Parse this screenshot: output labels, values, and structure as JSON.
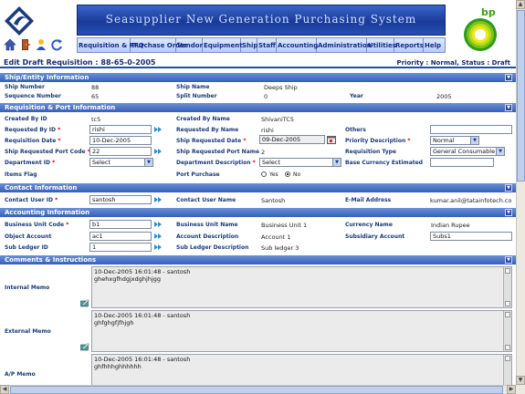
{
  "app_title": "Seasupplier New Generation Purchasing System",
  "brand": {
    "bp_text": "bp",
    "accent": "#2450b0",
    "section_color": "#3560b8",
    "required_color": "#d00000"
  },
  "toolbar_icons": [
    "home-icon",
    "exit-door-icon",
    "user-icon",
    "refresh-icon"
  ],
  "menu": {
    "items": [
      "Requisition & RFQ",
      "Purchase Order",
      "Vendor",
      "Equipment",
      "Ship",
      "Staff",
      "Accounting",
      "Administration",
      "Utilities",
      "Reports",
      "Help"
    ]
  },
  "page": {
    "title": "Edit Draft Requisition : 88-65-0-2005",
    "status": "Priority : Normal, Status : Draft"
  },
  "ship_entity": {
    "header": "Ship/Entity Information",
    "ship_number_label": "Ship Number",
    "ship_number": "88",
    "ship_name_label": "Ship Name",
    "ship_name": "Deeps Ship",
    "sequence_number_label": "Sequence Number",
    "sequence_number": "65",
    "split_number_label": "Split Number",
    "split_number": "0",
    "year_label": "Year",
    "year": "2005"
  },
  "requisition": {
    "header": "Requisition & Port Information",
    "created_by_id_label": "Created By ID",
    "created_by_id": "tc5",
    "created_by_name_label": "Created By Name",
    "created_by_name": "ShivaniTC5",
    "requested_by_id_label": "Requested By ID",
    "requested_by_id": "rishi",
    "requested_by_name_label": "Requested By Name",
    "requested_by_name": "rishi",
    "others_label": "Others",
    "others_value": "",
    "requisition_date_label": "Requisition Date",
    "requisition_date": "10-Dec-2005",
    "ship_requested_date_label": "Ship Requested Date",
    "ship_requested_date": "09-Dec-2005",
    "priority_label": "Priority Description",
    "priority": "Normal",
    "port_code_label": "Ship Requested Port Code",
    "port_code": "22",
    "port_name_label": "Ship Requested Port Name",
    "port_name": "2",
    "req_type_label": "Requisition Type",
    "req_type": "General Consumable",
    "department_id_label": "Department ID",
    "department_id": "Select",
    "department_desc_label": "Department Description",
    "department_desc": "Select",
    "base_currency_label": "Base Currency Estimated",
    "base_currency": "",
    "items_flag_label": "Items Flag",
    "port_purchase_label": "Port Purchase",
    "yes_label": "Yes",
    "no_label": "No",
    "port_purchase": "No"
  },
  "contact": {
    "header": "Contact Information",
    "user_id_label": "Contact User ID",
    "user_id": "santosh",
    "user_name_label": "Contact User Name",
    "user_name": "Santosh",
    "email_label": "E-Mail Address",
    "email": "kumar.anil@tatainfotech.co"
  },
  "accounting": {
    "header": "Accounting Information",
    "bu_code_label": "Business Unit Code",
    "bu_code": "b1",
    "bu_name_label": "Business Unit Name",
    "bu_name": "Business Unit 1",
    "currency_name_label": "Currency Name",
    "currency_name": "Indian Rupee",
    "object_account_label": "Object Account",
    "object_account": "ac1",
    "account_desc_label": "Account Description",
    "account_desc": "Account 1",
    "subsidiary_label": "Subsidiary Account",
    "subsidiary": "Subs1",
    "sub_ledger_id_label": "Sub Ledger ID",
    "sub_ledger_id": "1",
    "sub_ledger_desc_label": "Sub Ledger Description",
    "sub_ledger_desc": "Sub ledger 3"
  },
  "comments": {
    "header": "Comments & Instructions",
    "internal_label": "Internal Memo",
    "internal_line1": "10-Dec-2005 16:01:48 - santosh",
    "internal_line2": "ghehxgfhdgjxdghjhjgg",
    "external_label": "External Memo",
    "external_line1": "10-Dec-2005 16:01:48 - santosh",
    "external_line2": "ghfghgfjfhjgh",
    "ap_label": "A/P Memo",
    "ap_line1": "10-Dec-2005 16:01:48 - santosh",
    "ap_line2": "ghfhhhghhhhhh"
  }
}
